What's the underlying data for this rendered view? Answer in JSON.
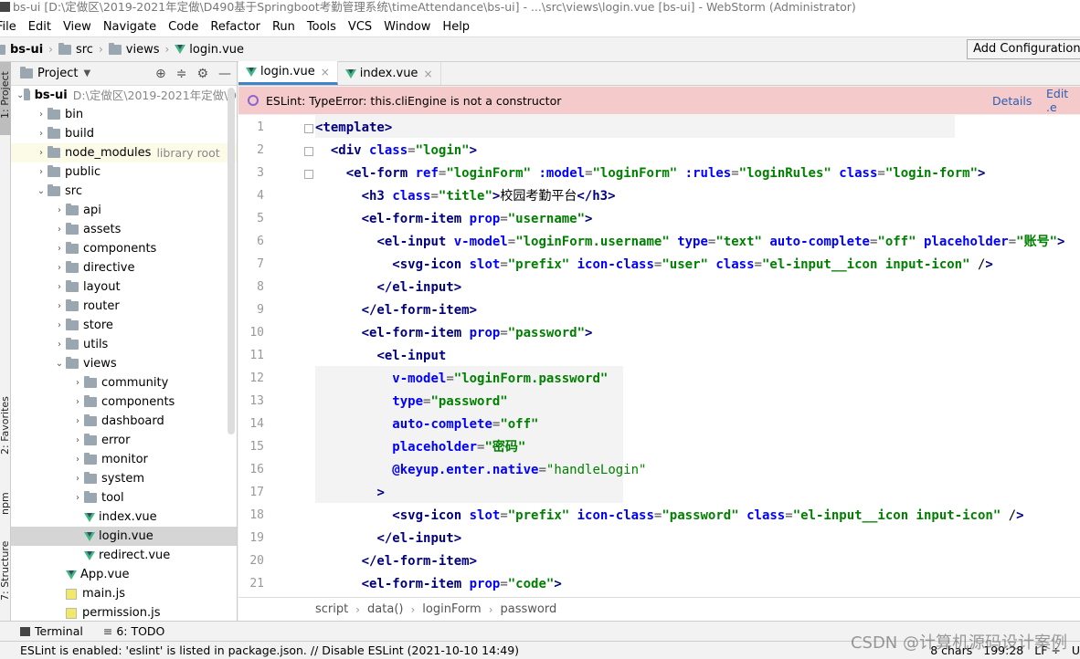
{
  "window": {
    "title": "bs-ui [D:\\定做区\\2019-2021年定做\\D490基于Springboot考勤管理系统\\timeAttendance\\bs-ui] - ...\\src\\views\\login.vue [bs-ui] - WebStorm (Administrator)"
  },
  "menu": [
    "File",
    "Edit",
    "View",
    "Navigate",
    "Code",
    "Refactor",
    "Run",
    "Tools",
    "VCS",
    "Window",
    "Help"
  ],
  "nav": {
    "crumbs": [
      "bs-ui",
      "src",
      "views",
      "login.vue"
    ],
    "add_config": "Add Configuration..."
  },
  "left_strip": {
    "project": "1: Project",
    "favorites": "2: Favorites",
    "npm": "npm",
    "structure": "7: Structure"
  },
  "project_panel": {
    "title": "Project",
    "root": {
      "name": "bs-ui",
      "path": "D:\\定做区\\2019-2021年定做\\D"
    },
    "items": [
      {
        "name": "bin",
        "level": 1,
        "kind": "folder",
        "arrow": "›"
      },
      {
        "name": "build",
        "level": 1,
        "kind": "folder",
        "arrow": "›"
      },
      {
        "name": "node_modules",
        "level": 1,
        "kind": "folder",
        "arrow": "›",
        "note": "library root"
      },
      {
        "name": "public",
        "level": 1,
        "kind": "folder",
        "arrow": "›"
      },
      {
        "name": "src",
        "level": 1,
        "kind": "folder",
        "arrow": "⌄"
      },
      {
        "name": "api",
        "level": 2,
        "kind": "folder",
        "arrow": "›"
      },
      {
        "name": "assets",
        "level": 2,
        "kind": "folder",
        "arrow": "›"
      },
      {
        "name": "components",
        "level": 2,
        "kind": "folder",
        "arrow": "›"
      },
      {
        "name": "directive",
        "level": 2,
        "kind": "folder",
        "arrow": "›"
      },
      {
        "name": "layout",
        "level": 2,
        "kind": "folder",
        "arrow": "›"
      },
      {
        "name": "router",
        "level": 2,
        "kind": "folder",
        "arrow": "›"
      },
      {
        "name": "store",
        "level": 2,
        "kind": "folder",
        "arrow": "›"
      },
      {
        "name": "utils",
        "level": 2,
        "kind": "folder",
        "arrow": "›"
      },
      {
        "name": "views",
        "level": 2,
        "kind": "folder",
        "arrow": "⌄"
      },
      {
        "name": "community",
        "level": 3,
        "kind": "folder",
        "arrow": "›"
      },
      {
        "name": "components",
        "level": 3,
        "kind": "folder",
        "arrow": "›"
      },
      {
        "name": "dashboard",
        "level": 3,
        "kind": "folder",
        "arrow": "›"
      },
      {
        "name": "error",
        "level": 3,
        "kind": "folder",
        "arrow": "›"
      },
      {
        "name": "monitor",
        "level": 3,
        "kind": "folder",
        "arrow": "›"
      },
      {
        "name": "system",
        "level": 3,
        "kind": "folder",
        "arrow": "›"
      },
      {
        "name": "tool",
        "level": 3,
        "kind": "folder",
        "arrow": "›"
      },
      {
        "name": "index.vue",
        "level": 3,
        "kind": "vue"
      },
      {
        "name": "login.vue",
        "level": 3,
        "kind": "vue",
        "selected": true
      },
      {
        "name": "redirect.vue",
        "level": 3,
        "kind": "vue"
      },
      {
        "name": "App.vue",
        "level": 2,
        "kind": "vue"
      },
      {
        "name": "main.js",
        "level": 2,
        "kind": "js"
      },
      {
        "name": "permission.js",
        "level": 2,
        "kind": "js"
      }
    ]
  },
  "tabs": [
    {
      "label": "login.vue",
      "active": true
    },
    {
      "label": "index.vue",
      "active": false
    }
  ],
  "eslint": {
    "message": "ESLint: TypeError: this.cliEngine is not a constructor",
    "details": "Details",
    "edit": "Edit .e"
  },
  "code": {
    "line_numbers": [
      "1",
      "2",
      "3",
      "4",
      "5",
      "6",
      "7",
      "8",
      "9",
      "10",
      "11",
      "12",
      "13",
      "14",
      "15",
      "16",
      "17",
      "18",
      "19",
      "20",
      "21"
    ],
    "lines": [
      "<template>",
      "  <div class=\"login\">",
      "    <el-form ref=\"loginForm\" :model=\"loginForm\" :rules=\"loginRules\" class=\"login-form\">",
      "      <h3 class=\"title\">校园考勤平台</h3>",
      "      <el-form-item prop=\"username\">",
      "        <el-input v-model=\"loginForm.username\" type=\"text\" auto-complete=\"off\" placeholder=\"账号\">",
      "          <svg-icon slot=\"prefix\" icon-class=\"user\" class=\"el-input__icon input-icon\" />",
      "        </el-input>",
      "      </el-form-item>",
      "      <el-form-item prop=\"password\">",
      "        <el-input",
      "          v-model=\"loginForm.password\"",
      "          type=\"password\"",
      "          auto-complete=\"off\"",
      "          placeholder=\"密码\"",
      "          @keyup.enter.native=\"handleLogin\"",
      "        >",
      "          <svg-icon slot=\"prefix\" icon-class=\"password\" class=\"el-input__icon input-icon\" />",
      "        </el-input>",
      "      </el-form-item>",
      "      <el-form-item prop=\"code\">"
    ]
  },
  "breadcrumb": [
    "script",
    "data()",
    "loginForm",
    "password"
  ],
  "toolwindows": [
    {
      "label": "Terminal"
    },
    {
      "label": "6: TODO"
    }
  ],
  "status": {
    "message": "ESLint is enabled: 'eslint' is listed in package.json. // Disable ESLint (2021-10-10 14:49)",
    "chars": "8 chars",
    "position": "199:28",
    "line_sep": "LF ÷",
    "encoding": "U"
  },
  "watermark": "CSDN @计算机源码设计案例"
}
